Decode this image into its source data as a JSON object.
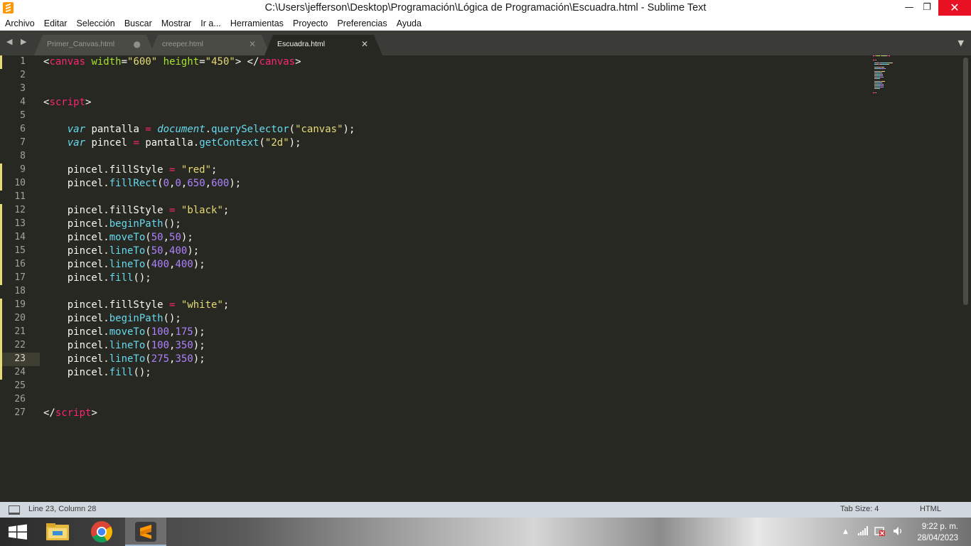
{
  "window": {
    "title": "C:\\Users\\jefferson\\Desktop\\Programación\\Lógica de Programación\\Escuadra.html - Sublime Text",
    "minimize": "—",
    "maximize": "❐",
    "close": "✕"
  },
  "menu": [
    "Archivo",
    "Editar",
    "Selección",
    "Buscar",
    "Mostrar",
    "Ir a...",
    "Herramientas",
    "Proyecto",
    "Preferencias",
    "Ayuda"
  ],
  "tabs": [
    {
      "label": "Primer_Canvas.html",
      "control": "●",
      "active": false
    },
    {
      "label": "creeper.html",
      "control": "✕",
      "active": false
    },
    {
      "label": "Escuadra.html",
      "control": "✕",
      "active": true
    }
  ],
  "nav_arrows": "◀ ▶",
  "tab_dropdown": "▼",
  "editor": {
    "current_line": 23,
    "modified_lines": [
      1,
      9,
      10,
      12,
      13,
      14,
      15,
      16,
      17,
      19,
      20,
      21,
      22,
      23,
      24
    ],
    "lines": [
      [
        [
          "t-punc",
          "<"
        ],
        [
          "t-tag",
          "canvas"
        ],
        [
          "t-punc",
          " "
        ],
        [
          "t-attr",
          "width"
        ],
        [
          "t-punc",
          "="
        ],
        [
          "t-str",
          "\"600\""
        ],
        [
          "t-punc",
          " "
        ],
        [
          "t-attr",
          "height"
        ],
        [
          "t-punc",
          "="
        ],
        [
          "t-str",
          "\"450\""
        ],
        [
          "t-punc",
          "> </"
        ],
        [
          "t-tag",
          "canvas"
        ],
        [
          "t-punc",
          ">"
        ]
      ],
      [],
      [],
      [
        [
          "t-punc",
          "<"
        ],
        [
          "t-tag",
          "script"
        ],
        [
          "t-punc",
          ">"
        ]
      ],
      [],
      [
        [
          "t-punc",
          "    "
        ],
        [
          "t-kw",
          "var"
        ],
        [
          "t-punc",
          " pantalla "
        ],
        [
          "t-op",
          "="
        ],
        [
          "t-punc",
          " "
        ],
        [
          "t-kw",
          "document"
        ],
        [
          "t-punc",
          "."
        ],
        [
          "t-fn",
          "querySelector"
        ],
        [
          "t-punc",
          "("
        ],
        [
          "t-str",
          "\"canvas\""
        ],
        [
          "t-punc",
          ");"
        ]
      ],
      [
        [
          "t-punc",
          "    "
        ],
        [
          "t-kw",
          "var"
        ],
        [
          "t-punc",
          " pincel "
        ],
        [
          "t-op",
          "="
        ],
        [
          "t-punc",
          " pantalla."
        ],
        [
          "t-fn",
          "getContext"
        ],
        [
          "t-punc",
          "("
        ],
        [
          "t-str",
          "\"2d\""
        ],
        [
          "t-punc",
          ");"
        ]
      ],
      [],
      [
        [
          "t-punc",
          "    pincel.fillStyle "
        ],
        [
          "t-op",
          "="
        ],
        [
          "t-punc",
          " "
        ],
        [
          "t-str",
          "\"red\""
        ],
        [
          "t-punc",
          ";"
        ]
      ],
      [
        [
          "t-punc",
          "    pincel."
        ],
        [
          "t-fn",
          "fillRect"
        ],
        [
          "t-punc",
          "("
        ],
        [
          "t-num",
          "0"
        ],
        [
          "t-punc",
          ","
        ],
        [
          "t-num",
          "0"
        ],
        [
          "t-punc",
          ","
        ],
        [
          "t-num",
          "650"
        ],
        [
          "t-punc",
          ","
        ],
        [
          "t-num",
          "600"
        ],
        [
          "t-punc",
          ");"
        ]
      ],
      [],
      [
        [
          "t-punc",
          "    pincel.fillStyle "
        ],
        [
          "t-op",
          "="
        ],
        [
          "t-punc",
          " "
        ],
        [
          "t-str",
          "\"black\""
        ],
        [
          "t-punc",
          ";"
        ]
      ],
      [
        [
          "t-punc",
          "    pincel."
        ],
        [
          "t-fn",
          "beginPath"
        ],
        [
          "t-punc",
          "();"
        ]
      ],
      [
        [
          "t-punc",
          "    pincel."
        ],
        [
          "t-fn",
          "moveTo"
        ],
        [
          "t-punc",
          "("
        ],
        [
          "t-num",
          "50"
        ],
        [
          "t-punc",
          ","
        ],
        [
          "t-num",
          "50"
        ],
        [
          "t-punc",
          ");"
        ]
      ],
      [
        [
          "t-punc",
          "    pincel."
        ],
        [
          "t-fn",
          "lineTo"
        ],
        [
          "t-punc",
          "("
        ],
        [
          "t-num",
          "50"
        ],
        [
          "t-punc",
          ","
        ],
        [
          "t-num",
          "400"
        ],
        [
          "t-punc",
          ");"
        ]
      ],
      [
        [
          "t-punc",
          "    pincel."
        ],
        [
          "t-fn",
          "lineTo"
        ],
        [
          "t-punc",
          "("
        ],
        [
          "t-num",
          "400"
        ],
        [
          "t-punc",
          ","
        ],
        [
          "t-num",
          "400"
        ],
        [
          "t-punc",
          ");"
        ]
      ],
      [
        [
          "t-punc",
          "    pincel."
        ],
        [
          "t-fn",
          "fill"
        ],
        [
          "t-punc",
          "();"
        ]
      ],
      [],
      [
        [
          "t-punc",
          "    pincel.fillStyle "
        ],
        [
          "t-op",
          "="
        ],
        [
          "t-punc",
          " "
        ],
        [
          "t-str",
          "\"white\""
        ],
        [
          "t-punc",
          ";"
        ]
      ],
      [
        [
          "t-punc",
          "    pincel."
        ],
        [
          "t-fn",
          "beginPath"
        ],
        [
          "t-punc",
          "();"
        ]
      ],
      [
        [
          "t-punc",
          "    pincel."
        ],
        [
          "t-fn",
          "moveTo"
        ],
        [
          "t-punc",
          "("
        ],
        [
          "t-num",
          "100"
        ],
        [
          "t-punc",
          ","
        ],
        [
          "t-num",
          "175"
        ],
        [
          "t-punc",
          ");"
        ]
      ],
      [
        [
          "t-punc",
          "    pincel."
        ],
        [
          "t-fn",
          "lineTo"
        ],
        [
          "t-punc",
          "("
        ],
        [
          "t-num",
          "100"
        ],
        [
          "t-punc",
          ","
        ],
        [
          "t-num",
          "350"
        ],
        [
          "t-punc",
          ");"
        ]
      ],
      [
        [
          "t-punc",
          "    pincel."
        ],
        [
          "t-fn",
          "lineTo"
        ],
        [
          "t-punc",
          "("
        ],
        [
          "t-num",
          "275"
        ],
        [
          "t-punc",
          ","
        ],
        [
          "t-num",
          "350"
        ],
        [
          "t-punc",
          ");"
        ]
      ],
      [
        [
          "t-punc",
          "    pincel."
        ],
        [
          "t-fn",
          "fill"
        ],
        [
          "t-punc",
          "();"
        ]
      ],
      [],
      [],
      [
        [
          "t-punc",
          "</"
        ],
        [
          "t-tag",
          "script"
        ],
        [
          "t-punc",
          ">"
        ]
      ]
    ]
  },
  "statusbar": {
    "position": "Line 23, Column 28",
    "tab_size": "Tab Size: 4",
    "syntax": "HTML"
  },
  "taskbar": {
    "time": "9:22 p. m.",
    "date": "28/04/2023",
    "tray_chevron": "▲"
  },
  "colors": {
    "editor_bg": "#272822",
    "tag": "#f92672",
    "attr": "#a6e22e",
    "string": "#e6db74",
    "function": "#66d9ef",
    "number": "#ae81ff",
    "close_button": "#e81123"
  }
}
